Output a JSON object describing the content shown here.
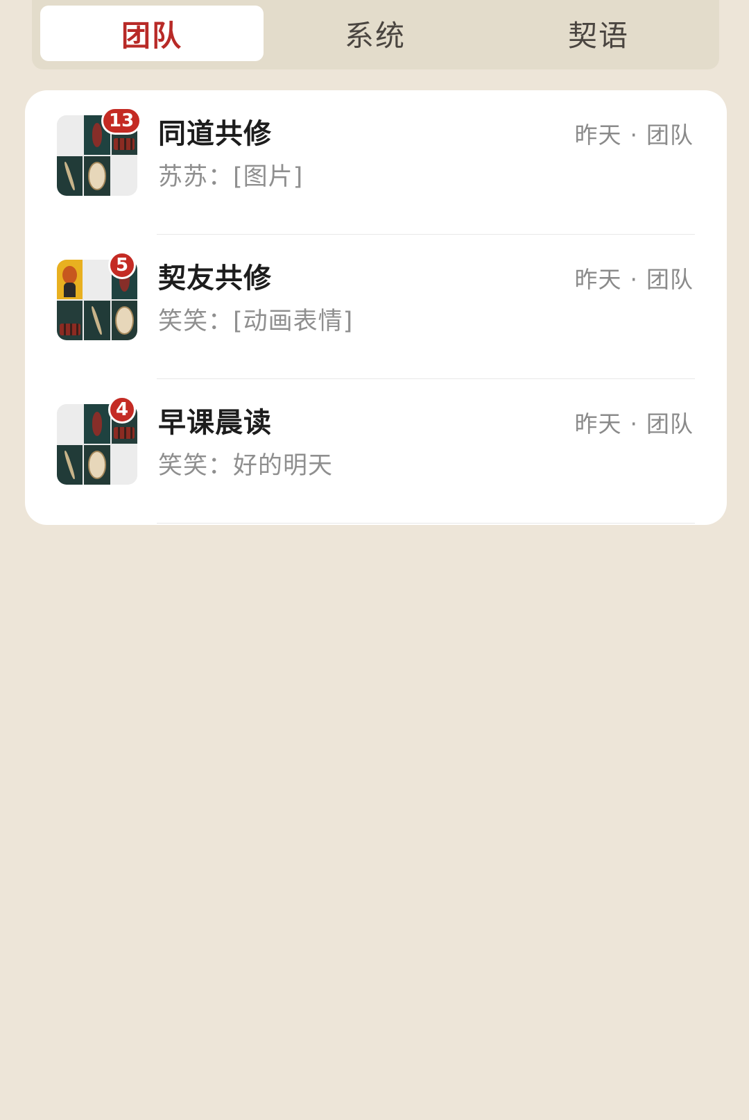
{
  "tabs": [
    {
      "label": "团队",
      "active": true
    },
    {
      "label": "系统",
      "active": false
    },
    {
      "label": "契语",
      "active": false
    }
  ],
  "conversations": [
    {
      "name": "同道共修",
      "sender": "苏苏",
      "message": "[图片]",
      "preview": "苏苏：[图片]",
      "time": "昨天",
      "category": "团队",
      "unread": "13"
    },
    {
      "name": "契友共修",
      "sender": "笑笑",
      "message": "[动画表情]",
      "preview": "笑笑：[动画表情]",
      "time": "昨天",
      "category": "团队",
      "unread": "5"
    },
    {
      "name": "早课晨读",
      "sender": "笑笑",
      "message": "好的明天",
      "preview": "笑笑：好的明天",
      "time": "昨天",
      "category": "团队",
      "unread": "4"
    }
  ],
  "colors": {
    "background": "#ede5d8",
    "tab_bar": "#e3dccb",
    "active_tab_text": "#b82a27",
    "badge": "#c42b24"
  }
}
